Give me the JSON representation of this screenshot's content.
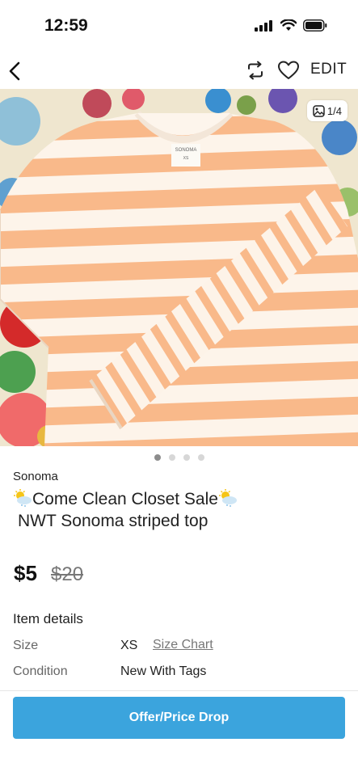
{
  "status_bar": {
    "time": "12:59"
  },
  "nav": {
    "back_icon": "chevron-left-icon",
    "share_icon": "repost-icon",
    "like_icon": "heart-icon",
    "edit_label": "EDIT"
  },
  "gallery": {
    "counter": "1/4",
    "image_description_icon": "image-icon",
    "dots_total": 4,
    "dots_active": 1
  },
  "listing": {
    "brand": "Sonoma",
    "title": "Come Clean Closet Sale",
    "title_line2": "NWT Sonoma striped top",
    "price": "$5",
    "original_price": "$20"
  },
  "item_details": {
    "heading": "Item details",
    "size_label": "Size",
    "size_value": "XS",
    "size_chart_link": "Size Chart",
    "condition_label": "Condition",
    "condition_value": "New With Tags"
  },
  "cta": {
    "label": "Offer/Price Drop"
  },
  "colors": {
    "accent": "#3ba4dd",
    "stripe": "#f9b98a",
    "text": "#222222"
  }
}
